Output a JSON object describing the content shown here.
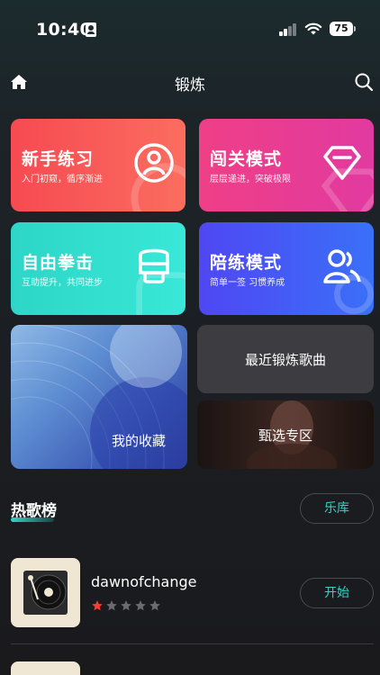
{
  "status_bar": {
    "time": "10:40",
    "battery": "75"
  },
  "header": {
    "title": "锻炼"
  },
  "cards": [
    {
      "title": "新手练习",
      "subtitle": "入门初窥，循序渐进"
    },
    {
      "title": "闯关模式",
      "subtitle": "层层递进，突破极限"
    },
    {
      "title": "自由拳击",
      "subtitle": "互助提升，共同进步"
    },
    {
      "title": "陪练模式",
      "subtitle": "简单一签 习惯养成"
    }
  ],
  "tiles": {
    "favorites": "我的收藏",
    "recent": "最近锻炼歌曲",
    "featured": "甄选专区"
  },
  "hot_section": {
    "title": "热歌榜",
    "library_button": "乐库"
  },
  "songs": [
    {
      "name": "dawnofchange",
      "rating": 1,
      "rating_max": 5,
      "start_label": "开始"
    }
  ],
  "colors": {
    "accent": "#35d2c3",
    "star_on": "#ff3b2f",
    "star_off": "#6b6b70"
  }
}
